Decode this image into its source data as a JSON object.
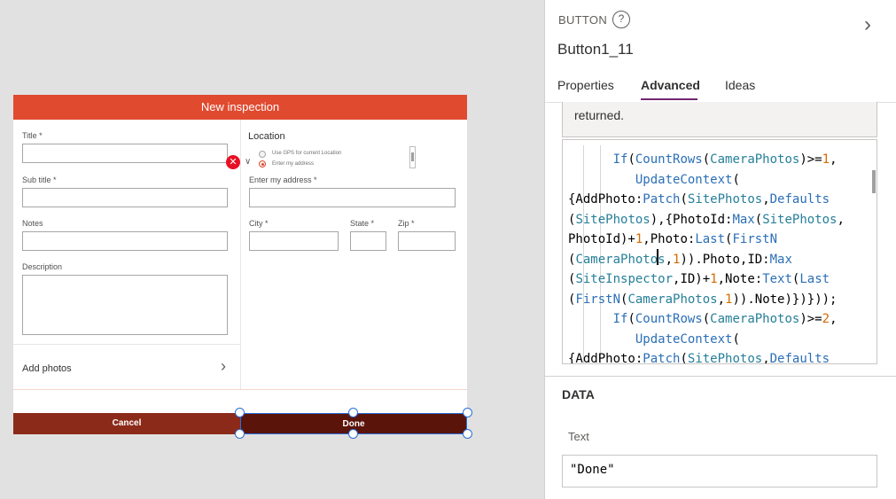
{
  "form": {
    "header_title": "New inspection",
    "title_label": "Title *",
    "subtitle_label": "Sub title *",
    "notes_label": "Notes",
    "description_label": "Description",
    "location_title": "Location",
    "radio_gps": "Use GPS for current Location",
    "radio_address": "Enter my address",
    "address_label": "Enter my address *",
    "city_label": "City *",
    "state_label": "State *",
    "zip_label": "Zip *",
    "add_photos": "Add photos",
    "cancel": "Cancel",
    "done": "Done"
  },
  "panel": {
    "control_type": "BUTTON",
    "help_symbol": "?",
    "control_name": "Button1_11",
    "tabs": [
      "Properties",
      "Advanced",
      "Ideas"
    ],
    "active_tab": "Advanced",
    "returned_text": "returned.",
    "data_title": "DATA",
    "text_property_label": "Text",
    "text_property_value": "\"Done\""
  },
  "colors": {
    "form_header": "#e04a2f",
    "cancel_button": "#8c2a1a",
    "done_button": "#5a1409",
    "selection": "#2b6fd6",
    "tab_underline": "#742774"
  },
  "icons": {
    "help": "question-circle-icon",
    "collapse": "chevron-right-icon",
    "error": "error-x-icon",
    "add_photos": "chevron-right-icon"
  }
}
